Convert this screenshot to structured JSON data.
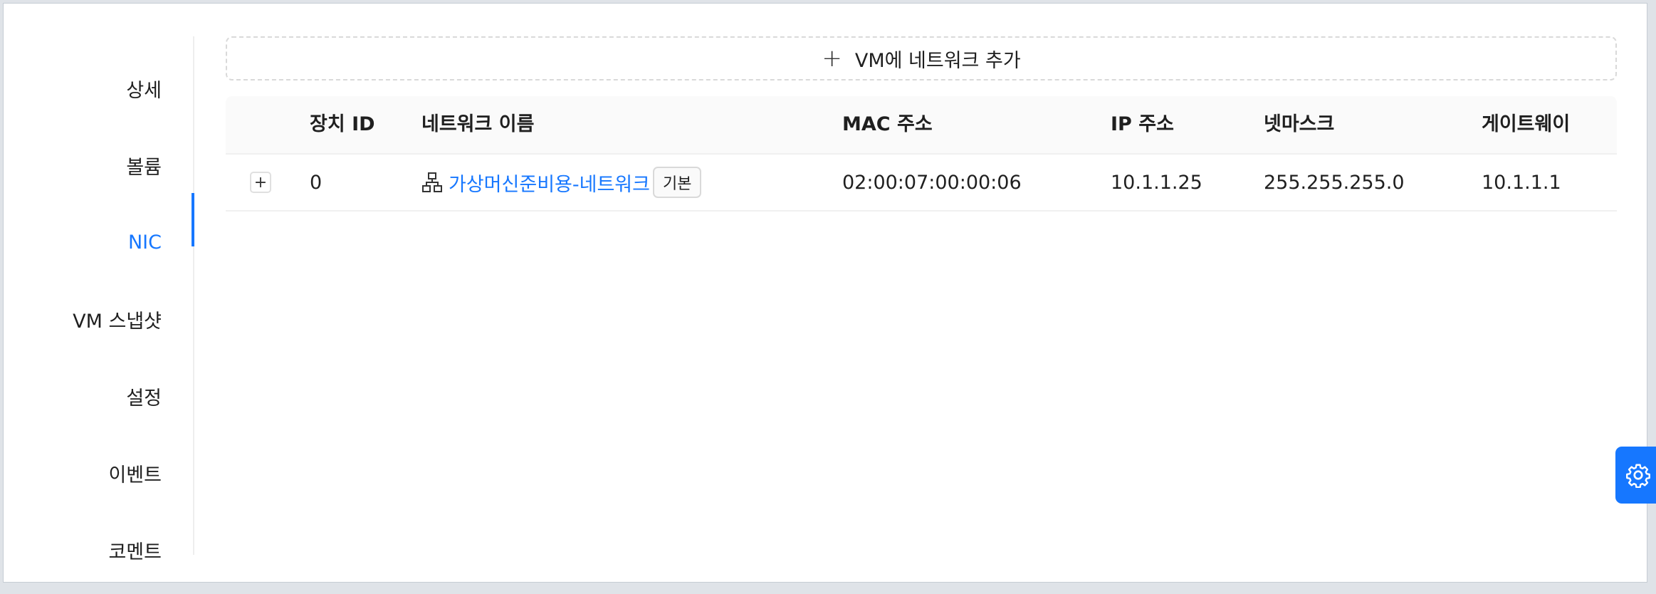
{
  "sidebar": {
    "items": [
      {
        "label": "상세"
      },
      {
        "label": "볼륨"
      },
      {
        "label": "NIC"
      },
      {
        "label": "VM 스냅샷"
      },
      {
        "label": "설정"
      },
      {
        "label": "이벤트"
      },
      {
        "label": "코멘트"
      }
    ],
    "active": "NIC"
  },
  "add_network_button": {
    "icon": "plus-icon",
    "label": "VM에 네트워크 추가"
  },
  "table": {
    "headers": {
      "device_id": "장치 ID",
      "network_name": "네트워크 이름",
      "mac": "MAC 주소",
      "ip": "IP 주소",
      "netmask": "넷마스크",
      "gateway": "게이트웨이"
    },
    "rows": [
      {
        "expand": "+",
        "device_id": "0",
        "network_name": "가상머신준비용-네트워크",
        "network_icon": "network-topology-icon",
        "tag": "기본",
        "mac": "02:00:07:00:00:06",
        "ip": "10.1.1.25",
        "netmask": "255.255.255.0",
        "gateway": "10.1.1.1"
      }
    ]
  },
  "colors": {
    "accent": "#1677ff",
    "header_bg": "#fafafa",
    "border": "#f0f0f0"
  }
}
